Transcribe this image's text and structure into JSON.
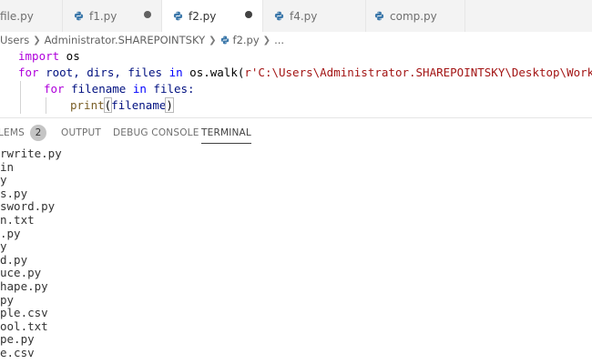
{
  "tabs": [
    {
      "label": "file.py",
      "state": "partial"
    },
    {
      "label": "f1.py",
      "state": "dirty"
    },
    {
      "label": "f2.py",
      "state": "active-dirty"
    },
    {
      "label": "f4.py",
      "state": "close"
    },
    {
      "label": "comp.py",
      "state": "close"
    }
  ],
  "breadcrumb": {
    "items": [
      "Users",
      "Administrator.SHAREPOINTSKY",
      "f2.py",
      "..."
    ]
  },
  "editor": {
    "line1": {
      "kw": "import",
      "rest": " os"
    },
    "line2": {
      "for_kw": "for",
      "vars": " root, dirs, files ",
      "in_kw": "in",
      "call": " os.walk(",
      "str": "r'C:\\Users\\Administrator.SHAREPOINTSKY\\Desktop\\Work'",
      "end": "):"
    },
    "line3": {
      "for_kw": "for",
      "var": " filename ",
      "in_kw": "in",
      "rest": " files:"
    },
    "line4": {
      "fn": "print",
      "open": "(",
      "arg": "filename",
      "close": ")"
    }
  },
  "panel": {
    "tabs": [
      "LEMS",
      "OUTPUT",
      "DEBUG CONSOLE",
      "TERMINAL"
    ],
    "problems_count": "2",
    "active_tab": "TERMINAL"
  },
  "terminal": {
    "lines": [
      "rwrite.py",
      "in",
      "y",
      "s.py",
      "sword.py",
      "n.txt",
      ".py",
      "y",
      "d.py",
      "uce.py",
      "hape.py",
      "py",
      "ple.csv",
      "ool.txt",
      "pe.py",
      "e.csv"
    ]
  },
  "colors": {
    "keyword": "#0000ff",
    "control_keyword": "#af00db",
    "function": "#795e26",
    "string": "#a31515",
    "variable": "#001080",
    "python_icon": "#3c78aa"
  }
}
